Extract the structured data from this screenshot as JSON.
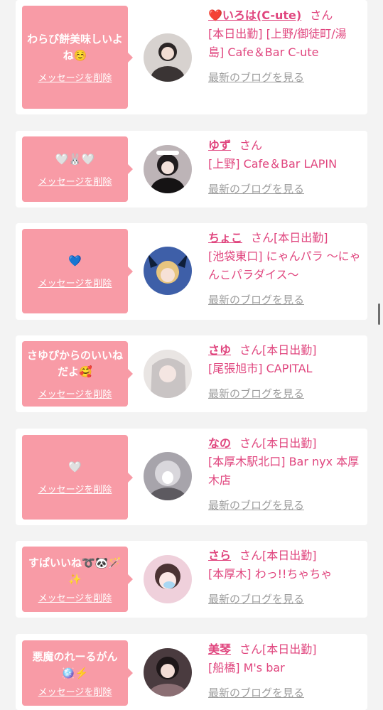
{
  "cards": [
    {
      "message": "わらび餅美味しいよね☺️",
      "delete_label": "メッセージを削除",
      "name": "❤️いろは(C-ute)",
      "san": "さん",
      "status": "",
      "shop": "[本日出勤] [上野/御徒町/湯島] Cafe＆Bar C-ute",
      "blog_label": "最新のブログを見る",
      "avatar_color": "#d7d2cf"
    },
    {
      "message": "🤍🐰🤍",
      "delete_label": "メッセージを削除",
      "name": "ゆず",
      "san": "さん",
      "status": "",
      "shop": "[上野] Cafe＆Bar LAPIN",
      "blog_label": "最新のブログを見る",
      "avatar_color": "#bdb4b7"
    },
    {
      "message": "💙",
      "delete_label": "メッセージを削除",
      "name": "ちょこ",
      "san": "さん",
      "status": "[本日出勤]",
      "shop": "[池袋東口] にゃんパラ 〜にゃんこパラダイス〜",
      "blog_label": "最新のブログを見る",
      "avatar_color": "#3e5fa8"
    },
    {
      "message": "さゆぴからのいいねだよ🥰",
      "delete_label": "メッセージを削除",
      "name": "さゆ",
      "san": "さん",
      "status": "[本日出勤]",
      "shop": "[尾張旭市] CAPITAL",
      "blog_label": "最新のブログを見る",
      "avatar_color": "#e9e5e3"
    },
    {
      "message": "🤍",
      "delete_label": "メッセージを削除",
      "name": "なの",
      "san": "さん",
      "status": "[本日出勤]",
      "shop": "[本厚木駅北口] Bar nyx 本厚木店",
      "blog_label": "最新のブログを見る",
      "avatar_color": "#a7a4ab"
    },
    {
      "message": "すぱいいね➰🐼🪄✨",
      "delete_label": "メッセージを削除",
      "name": "さら",
      "san": "さん",
      "status": "[本日出勤]",
      "shop": "[本厚木] わっ!!ちゃちゃ",
      "blog_label": "最新のブログを見る",
      "avatar_color": "#efd0db"
    },
    {
      "message": "悪魔のれーるがん🪩⚡️",
      "delete_label": "メッセージを削除",
      "name": "美琴",
      "san": "さん",
      "status": "[本日出勤]",
      "shop": "[船橋] M's bar",
      "blog_label": "最新のブログを見る",
      "avatar_color": "#4a3b3f"
    }
  ]
}
